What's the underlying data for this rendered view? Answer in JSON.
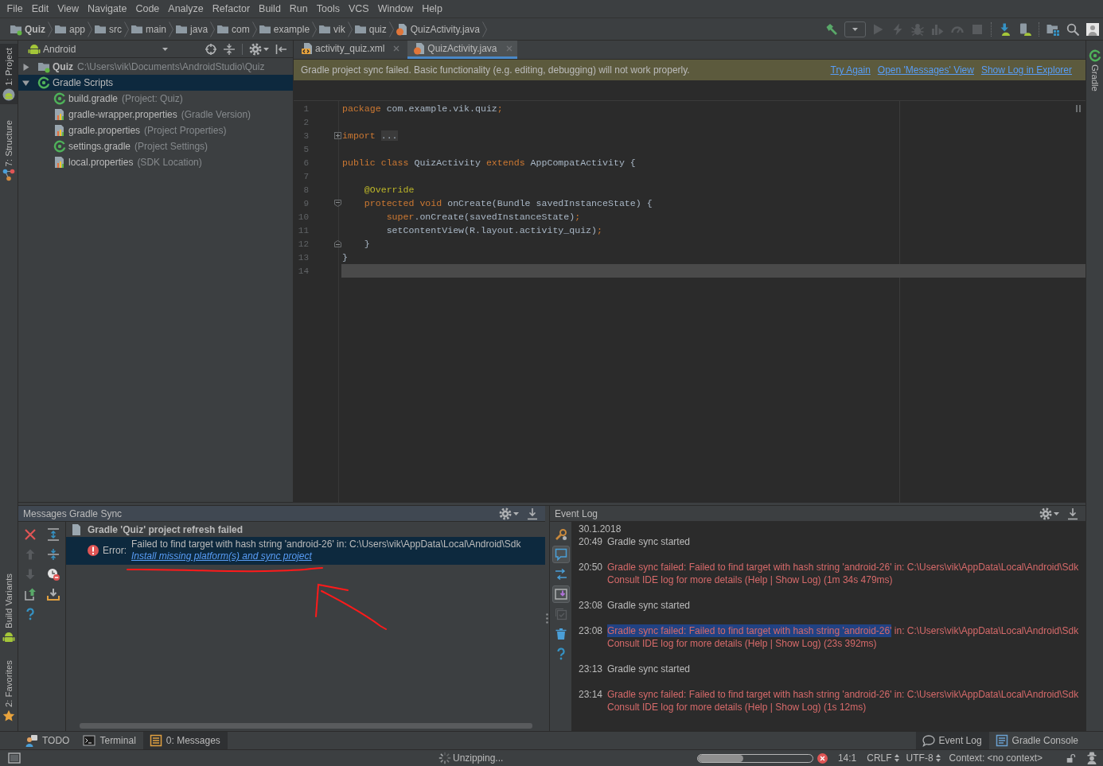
{
  "menu_bar": {
    "items": [
      "File",
      "Edit",
      "View",
      "Navigate",
      "Code",
      "Analyze",
      "Refactor",
      "Build",
      "Run",
      "Tools",
      "VCS",
      "Window",
      "Help"
    ]
  },
  "navigation_bar": {
    "crumbs": [
      {
        "label": "Quiz",
        "kind": "module"
      },
      {
        "label": "app",
        "kind": "folder"
      },
      {
        "label": "src",
        "kind": "folder"
      },
      {
        "label": "main",
        "kind": "folder"
      },
      {
        "label": "java",
        "kind": "folder"
      },
      {
        "label": "com",
        "kind": "folder"
      },
      {
        "label": "example",
        "kind": "folder"
      },
      {
        "label": "vik",
        "kind": "folder"
      },
      {
        "label": "quiz",
        "kind": "folder"
      },
      {
        "label": "QuizActivity.java",
        "kind": "java"
      }
    ]
  },
  "toolbar": {
    "groups": [
      [
        {
          "kind": "build",
          "disabled": false
        },
        {
          "kind": "config-select",
          "disabled": false
        },
        {
          "kind": "run",
          "disabled": true
        },
        {
          "kind": "apply-changes",
          "disabled": true
        },
        {
          "kind": "debug",
          "disabled": true
        },
        {
          "kind": "coverage",
          "disabled": true
        },
        {
          "kind": "profile",
          "disabled": true
        },
        {
          "kind": "stop",
          "disabled": true
        }
      ],
      [
        {
          "kind": "sdk-manager",
          "disabled": false
        },
        {
          "kind": "avd-manager",
          "disabled": false
        }
      ],
      [
        {
          "kind": "project-structure",
          "disabled": false
        },
        {
          "kind": "search",
          "disabled": false
        },
        {
          "kind": "profile-avatar",
          "disabled": false
        }
      ]
    ]
  },
  "left_tool_bar": {
    "top": [
      {
        "label": "1: Project",
        "kind": "project",
        "selected": true
      },
      {
        "label": "7: Structure",
        "kind": "structure",
        "selected": false
      }
    ],
    "bottom": [
      {
        "label": "Build Variants",
        "kind": "build-variants",
        "selected": false
      },
      {
        "label": "2: Favorites",
        "kind": "favorites",
        "selected": false
      }
    ]
  },
  "project_panel": {
    "view": "Android",
    "tree": [
      {
        "name": "Quiz",
        "detail": "C:\\Users\\vik\\Documents\\AndroidStudio\\Quiz",
        "kind": "module",
        "expanded": false,
        "selected": false
      },
      {
        "name": "Gradle Scripts",
        "kind": "gradle",
        "expanded": true,
        "selected": true,
        "children": [
          {
            "name": "build.gradle",
            "detail": "(Project: Quiz)",
            "kind": "gradle",
            "selected": false
          },
          {
            "name": "gradle-wrapper.properties",
            "detail": "(Gradle Version)",
            "kind": "properties",
            "selected": false
          },
          {
            "name": "gradle.properties",
            "detail": "(Project Properties)",
            "kind": "properties",
            "selected": false
          },
          {
            "name": "settings.gradle",
            "detail": "(Project Settings)",
            "kind": "gradle",
            "selected": false
          },
          {
            "name": "local.properties",
            "detail": "(SDK Location)",
            "kind": "properties",
            "selected": false
          }
        ]
      }
    ]
  },
  "editor": {
    "tabs": [
      {
        "label": "activity_quiz.xml",
        "kind": "xml",
        "selected": false
      },
      {
        "label": "QuizActivity.java",
        "kind": "java",
        "selected": true
      }
    ],
    "banner": {
      "message": "Gradle project sync failed. Basic functionality (e.g. editing, debugging) will not work properly.",
      "links": [
        "Try Again",
        "Open 'Messages' View",
        "Show Log in Explorer"
      ]
    },
    "lines": [
      {
        "number": "1",
        "kind": "code",
        "current": false,
        "tokens": [
          {
            "kind": "keyword",
            "text": "package"
          },
          {
            "kind": "plain",
            "text": " com.example.vik.quiz"
          },
          {
            "kind": "keyword",
            "text": ";"
          }
        ]
      },
      {
        "number": "2",
        "kind": "code",
        "current": false
      },
      {
        "number": "3",
        "kind": "folded",
        "current": false,
        "tokens": [
          {
            "kind": "keyword",
            "text": "import "
          },
          {
            "kind": "folded",
            "text": "..."
          }
        ]
      },
      {
        "number": "5",
        "kind": "code",
        "current": false
      },
      {
        "number": "6",
        "kind": "code",
        "current": false,
        "tokens": [
          {
            "kind": "keyword",
            "text": "public class "
          },
          {
            "kind": "plain",
            "text": "QuizActivity "
          },
          {
            "kind": "keyword",
            "text": "extends "
          },
          {
            "kind": "plain",
            "text": "AppCompatActivity {"
          }
        ]
      },
      {
        "number": "7",
        "kind": "code",
        "current": false
      },
      {
        "number": "8",
        "kind": "code",
        "current": false,
        "tokens": [
          {
            "kind": "annotation",
            "text": "    @Override"
          }
        ]
      },
      {
        "number": "9",
        "kind": "fold-start",
        "current": false,
        "tokens": [
          {
            "kind": "keyword",
            "text": "    protected void "
          },
          {
            "kind": "plain",
            "text": "onCreate(Bundle savedInstanceState) {"
          }
        ]
      },
      {
        "number": "10",
        "kind": "code",
        "current": false,
        "tokens": [
          {
            "kind": "keyword",
            "text": "        super"
          },
          {
            "kind": "plain",
            "text": ".onCreate(savedInstanceState)"
          },
          {
            "kind": "keyword",
            "text": ";"
          }
        ]
      },
      {
        "number": "11",
        "kind": "code",
        "current": false,
        "tokens": [
          {
            "kind": "plain",
            "text": "        setContentView(R.layout.activity_quiz)"
          },
          {
            "kind": "keyword",
            "text": ";"
          }
        ]
      },
      {
        "number": "12",
        "kind": "fold-end",
        "current": false,
        "tokens": [
          {
            "kind": "plain",
            "text": "    }"
          }
        ]
      },
      {
        "number": "13",
        "kind": "code",
        "current": false,
        "tokens": [
          {
            "kind": "plain",
            "text": "}"
          }
        ]
      },
      {
        "number": "14",
        "kind": "code",
        "current": true
      }
    ]
  },
  "right_tool_bar": {
    "items": [
      {
        "label": "Gradle",
        "kind": "gradle",
        "selected": false
      }
    ]
  },
  "messages_panel": {
    "title": "Messages Gradle Sync",
    "tools": [
      [
        {
          "kind": "close",
          "disabled": false
        },
        {
          "kind": "previous",
          "disabled": true
        },
        {
          "kind": "next",
          "disabled": true
        },
        {
          "kind": "export",
          "disabled": false
        },
        {
          "kind": "help",
          "disabled": false
        }
      ],
      [
        {
          "kind": "expand-all",
          "disabled": false
        },
        {
          "kind": "collapse-all",
          "disabled": false
        },
        {
          "kind": "hide-warnings",
          "disabled": false
        },
        {
          "kind": "autoscroll",
          "disabled": false
        }
      ]
    ],
    "items": [
      {
        "text": "Gradle 'Quiz' project refresh failed",
        "kind": "file",
        "selected": false,
        "children": [
          {
            "kind": "error",
            "label": "Error:",
            "message": "Failed to find target with hash string 'android-26' in: C:\\Users\\vik\\AppData\\Local\\Android\\Sdk",
            "link": "Install missing platform(s) and sync project",
            "selected": true
          }
        ]
      }
    ]
  },
  "event_log": {
    "title": "Event Log",
    "tools": [
      {
        "kind": "settings",
        "on": false,
        "disabled": false
      },
      {
        "kind": "balloons",
        "on": true,
        "disabled": false
      },
      {
        "kind": "soft-wrap",
        "on": false,
        "disabled": false
      },
      {
        "kind": "scroll-to-end",
        "on": true,
        "disabled": false
      },
      {
        "kind": "mark-read",
        "on": false,
        "disabled": true
      },
      {
        "kind": "clear",
        "on": false,
        "disabled": false
      },
      {
        "kind": "help",
        "on": false,
        "disabled": false
      }
    ],
    "date": "30.1.2018",
    "entries": [
      {
        "time": "20:49",
        "kind": "info",
        "parts": [
          {
            "text": "Gradle sync started",
            "selected": false
          }
        ]
      },
      {
        "time": "20:50",
        "kind": "error",
        "parts": [
          {
            "text": "Gradle sync failed: Failed to find target with hash string 'android-26' in: C:\\Users\\vik\\AppData\\Local\\Android\\Sdk",
            "selected": false
          }
        ],
        "detail": "Consult IDE log for more details (Help | Show Log) (1m 34s 479ms)"
      },
      {
        "time": "23:08",
        "kind": "info",
        "parts": [
          {
            "text": "Gradle sync started",
            "selected": false
          }
        ]
      },
      {
        "time": "23:08",
        "kind": "error",
        "parts": [
          {
            "text": "Gradle sync failed: Failed to find target with hash string 'android-26'",
            "selected": true
          },
          {
            "text": " in: C:\\Users\\vik\\AppData\\Local\\Android\\Sdk",
            "selected": false
          }
        ],
        "detail": "Consult IDE log for more details (Help | Show Log) (23s 392ms)"
      },
      {
        "time": "23:13",
        "kind": "info",
        "parts": [
          {
            "text": "Gradle sync started",
            "selected": false
          }
        ]
      },
      {
        "time": "23:14",
        "kind": "error",
        "parts": [
          {
            "text": "Gradle sync failed: Failed to find target with hash string 'android-26' in: C:\\Users\\vik\\AppData\\Local\\Android\\Sdk",
            "selected": false
          }
        ],
        "detail": "Consult IDE log for more details (Help | Show Log) (1s 12ms)"
      }
    ]
  },
  "bottom_tool_bar": {
    "left": [
      {
        "label": "TODO",
        "kind": "todo",
        "selected": false
      },
      {
        "label": "Terminal",
        "kind": "terminal",
        "selected": false
      },
      {
        "label": "0: Messages",
        "kind": "messages",
        "selected": true
      }
    ],
    "right": [
      {
        "label": "Event Log",
        "kind": "event-log",
        "selected": true
      },
      {
        "label": "Gradle Console",
        "kind": "console",
        "selected": false
      }
    ]
  },
  "status_bar": {
    "task": "Unzipping...",
    "progress": {
      "level": 0.4
    },
    "position": "14:1",
    "line_separator": "CRLF",
    "encoding": "UTF-8",
    "context": "Context: <no context>"
  }
}
